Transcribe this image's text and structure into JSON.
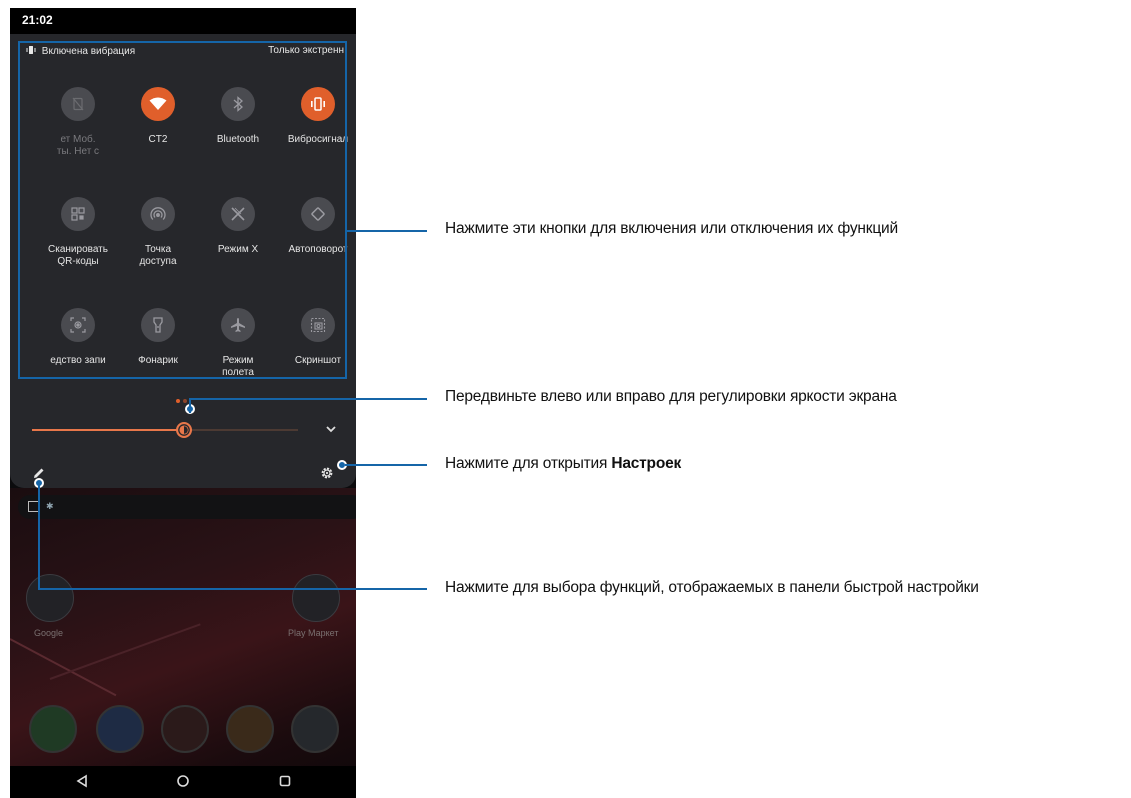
{
  "status_bar": {
    "time": "21:02"
  },
  "quick_settings": {
    "vibration_status": "Включена вибрация",
    "dnd_status": "Только экстренн",
    "tiles": [
      {
        "name": "mobile-data",
        "label": "ет    Моб.\nты.    Нет с",
        "icon": "no-sim-icon",
        "active": false,
        "dim": true
      },
      {
        "name": "wifi",
        "label": "CT2",
        "icon": "wifi-icon",
        "active": true
      },
      {
        "name": "bluetooth",
        "label": "Bluetooth",
        "icon": "bluetooth-icon",
        "active": false
      },
      {
        "name": "vibration",
        "label": "Вибросигнал",
        "icon": "vibrate-icon",
        "active": true
      },
      {
        "name": "qr-scan",
        "label": "Сканировать\nQR-коды",
        "icon": "qr-code-icon",
        "active": false
      },
      {
        "name": "hotspot",
        "label": "Точка\nдоступа",
        "icon": "hotspot-icon",
        "active": false
      },
      {
        "name": "x-mode",
        "label": "Режим X",
        "icon": "x-mode-icon",
        "active": false
      },
      {
        "name": "auto-rotate",
        "label": "Автоповорот",
        "icon": "rotate-icon",
        "active": false
      },
      {
        "name": "screen-recorder",
        "label": "едство запи",
        "icon": "screen-record-icon",
        "active": false
      },
      {
        "name": "flashlight",
        "label": "Фонарик",
        "icon": "flashlight-icon",
        "active": false
      },
      {
        "name": "airplane-mode",
        "label": "Режим\nполета",
        "icon": "airplane-icon",
        "active": false
      },
      {
        "name": "screenshot",
        "label": "Скриншот",
        "icon": "screenshot-icon",
        "active": false
      }
    ],
    "brightness_level": 0.57,
    "accent_color": "#e05f2b"
  },
  "home": {
    "apps": [
      {
        "label": "Google"
      },
      {
        "label": "Play Маркет"
      }
    ]
  },
  "annotations": {
    "tiles": "Нажмите эти кнопки для включения или отключения их функций",
    "brightness": "Передвиньте влево или вправо для регулировки яркости экрана",
    "settings_prefix": "Нажмите для открытия ",
    "settings_bold": "Настроек",
    "edit": "Нажмите для выбора функций, отображаемых в панели быстрой настройки",
    "line_color": "#1565a8"
  }
}
